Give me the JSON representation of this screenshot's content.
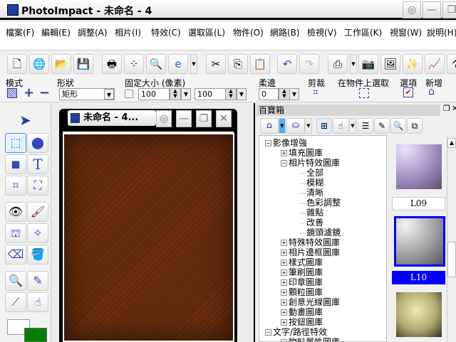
{
  "title": "PhotoImpact - 未命名 - 4",
  "menu": [
    "檔案(F)",
    "編輯(E)",
    "調整(A)",
    "相片(I)",
    "特效(C)",
    "選取區(L)",
    "物件(O)",
    "網路(B)",
    "檢視(V)",
    "工作區(K)",
    "視窗(W)",
    "說明(H)"
  ],
  "props": {
    "mode_label": "模式",
    "shape_label": "形狀",
    "shape_value": "矩形",
    "fixed_label": "固定大小 (像素)",
    "width": "100",
    "height": "100",
    "soft_label": "柔邊",
    "soft_value": "0",
    "crop_label": "剪裁",
    "select_obj_label": "在物件上選取",
    "options_label": "選項",
    "new_label": "新增"
  },
  "doc": {
    "title": "未命名 - 4..."
  },
  "panel": {
    "title": "百寶箱",
    "tree": [
      {
        "label": "影像增強",
        "level": 0,
        "sign": "-"
      },
      {
        "label": "填充圖庫",
        "level": 1,
        "sign": "+"
      },
      {
        "label": "相片特效圖庫",
        "level": 1,
        "sign": "-"
      },
      {
        "label": "全部",
        "level": 2
      },
      {
        "label": "模糊",
        "level": 2
      },
      {
        "label": "清晰",
        "level": 2
      },
      {
        "label": "色彩調整",
        "level": 2
      },
      {
        "label": "雜點",
        "level": 2
      },
      {
        "label": "改善",
        "level": 2
      },
      {
        "label": "鏡頭濾鏡",
        "level": 2
      },
      {
        "label": "特殊特效圖庫",
        "level": 1,
        "sign": "+"
      },
      {
        "label": "相片邊框圖庫",
        "level": 1,
        "sign": "+"
      },
      {
        "label": "樣式圖庫",
        "level": 1,
        "sign": "+"
      },
      {
        "label": "筆刷圖庫",
        "level": 1,
        "sign": "+"
      },
      {
        "label": "印章圖庫",
        "level": 1,
        "sign": "+"
      },
      {
        "label": "顆粒圖庫",
        "level": 1,
        "sign": "+"
      },
      {
        "label": "創意光線圖庫",
        "level": 1,
        "sign": "+"
      },
      {
        "label": "動畫圖庫",
        "level": 1,
        "sign": "+"
      },
      {
        "label": "按鈕圖庫",
        "level": 1,
        "sign": "+"
      },
      {
        "label": "文字/路徑特效",
        "level": 0,
        "sign": "-"
      },
      {
        "label": "物料屬性圖庫",
        "level": 1,
        "sign": "+"
      }
    ],
    "thumbs": [
      {
        "label": "L09",
        "selected": false
      },
      {
        "label": "L10",
        "selected": true
      }
    ]
  },
  "colors": {
    "foreground": "#ffffff",
    "background": "#008000",
    "selection": "#0000ff"
  }
}
